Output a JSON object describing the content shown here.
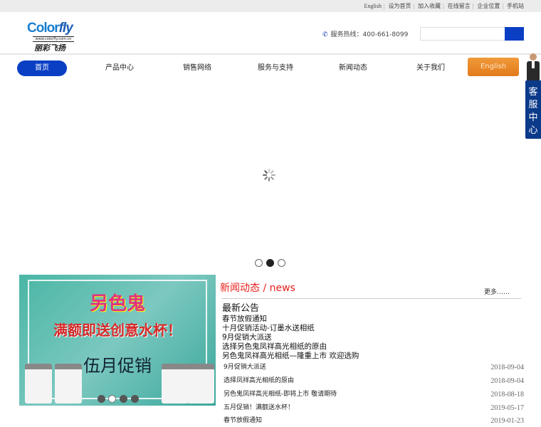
{
  "topbar": {
    "links": [
      "English",
      "设为首页",
      "加入收藏",
      "在线留言",
      "企业位置",
      "手机站"
    ]
  },
  "header": {
    "logo": {
      "brand": "Color",
      "brand_accent": "fly",
      "url": "www.colorfly.com.cn",
      "cn": "丽彩飞扬"
    },
    "hotline": "服务热线：400-661-8099",
    "search": {
      "placeholder": "",
      "value": ""
    }
  },
  "nav": {
    "items": [
      "首页",
      "产品中心",
      "销售网络",
      "服务与支持",
      "新闻动态",
      "关于我们"
    ],
    "english": "English"
  },
  "side": {
    "service": "客服中心"
  },
  "slider": {
    "dots": 3,
    "active": 2
  },
  "promo": {
    "brand": "另色鬼",
    "slogan": "满额即送创意水杯！",
    "month": "伍月促销",
    "dots": 4,
    "active": 2
  },
  "news": {
    "title": "新闻动态 / news",
    "more": "更多……",
    "notice": {
      "heading": "最新公告",
      "items": [
        "春节放假通知",
        "十月促销活动-订墨水送相纸",
        "9月促销大派送",
        "选择另色鬼凤祥高光相纸的原由",
        "另色鬼凤祥高光相纸—隆重上市 欢迎选购"
      ]
    },
    "list": [
      {
        "title": "9月促销大派送",
        "date": "2018-09-04"
      },
      {
        "title": "选择凤祥高光相纸的原由",
        "date": "2018-09-04"
      },
      {
        "title": "另色鬼凤祥高光相纸-即将上市 敬请期待",
        "date": "2018-08-18"
      },
      {
        "title": "五月促销！满额送水杯！",
        "date": "2019-05-17"
      },
      {
        "title": "春节放假通知",
        "date": "2019-01-23"
      }
    ]
  },
  "colors": {
    "primary": "#0a3fc4",
    "accent": "#e8201c",
    "orange": "#e8841f",
    "service": "#0b3a8a"
  }
}
